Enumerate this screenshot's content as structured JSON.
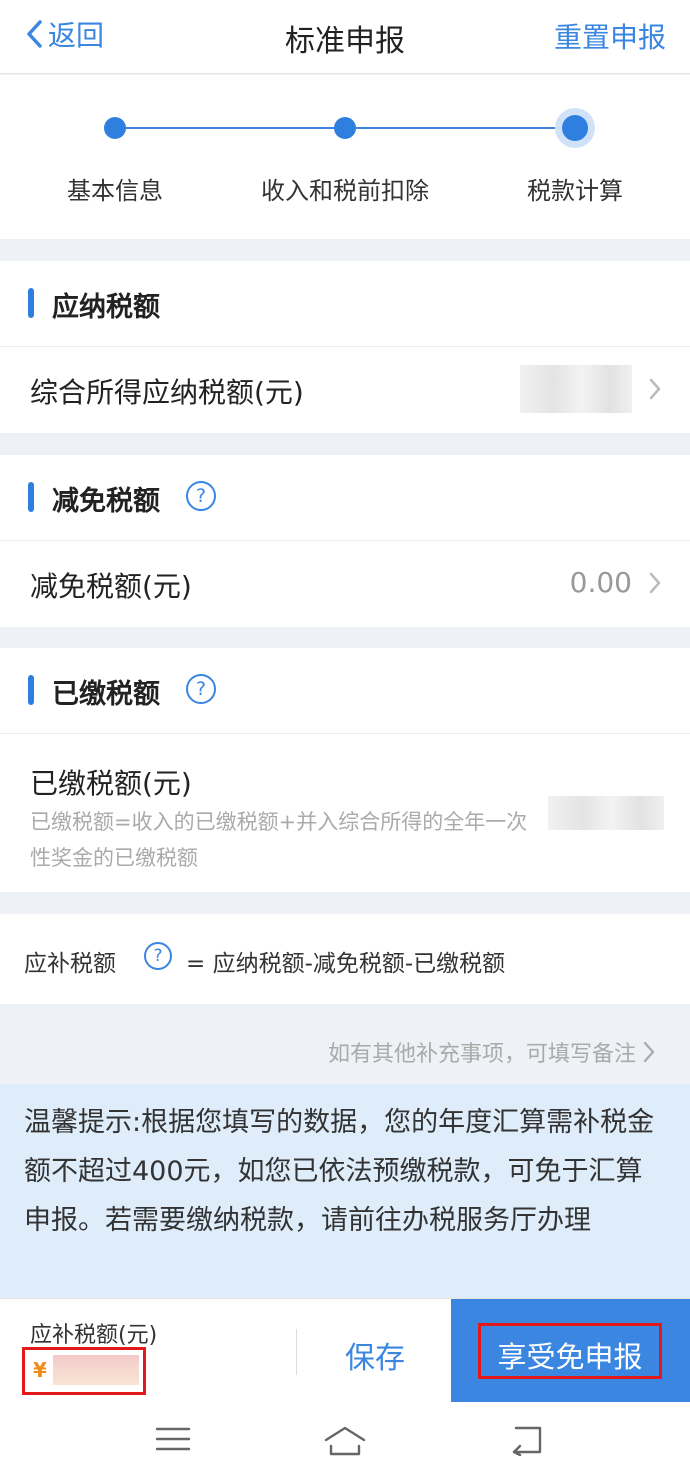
{
  "header": {
    "back_label": "返回",
    "title": "标准申报",
    "reset_label": "重置申报"
  },
  "steps": [
    {
      "label": "基本信息",
      "state": "done"
    },
    {
      "label": "收入和税前扣除",
      "state": "done"
    },
    {
      "label": "税款计算",
      "state": "active"
    }
  ],
  "tax_payable": {
    "section_title": "应纳税额",
    "row_label": "综合所得应纳税额(元)"
  },
  "tax_reduction": {
    "section_title": "减免税额",
    "row_label": "减免税额(元)",
    "row_value": "0.00"
  },
  "tax_paid": {
    "section_title": "已缴税额",
    "row_label": "已缴税额(元)",
    "description": "已缴税额=收入的已缴税额+并入综合所得的全年一次性奖金的已缴税额"
  },
  "formula": {
    "label": "应补税额",
    "text": "= 应纳税额-减免税额-已缴税额"
  },
  "note_link": "如有其他补充事项，可填写备注",
  "tip": "温馨提示:根据您填写的数据，您的年度汇算需补税金额不超过400元，如您已依法预缴税款，可免于汇算申报。若需要缴纳税款，请前往办税服务厅办理",
  "bottom": {
    "due_label": "应补税额(元)",
    "currency": "¥",
    "save_label": "保存",
    "exempt_label": "享受免申报"
  },
  "colors": {
    "accent": "#3a86e0",
    "highlight": "#e31818",
    "tip_bg": "#dfedfb"
  },
  "icons": [
    "chevron-left-icon",
    "help-icon",
    "chevron-right-icon",
    "menu-icon",
    "home-icon",
    "back-nav-icon"
  ]
}
